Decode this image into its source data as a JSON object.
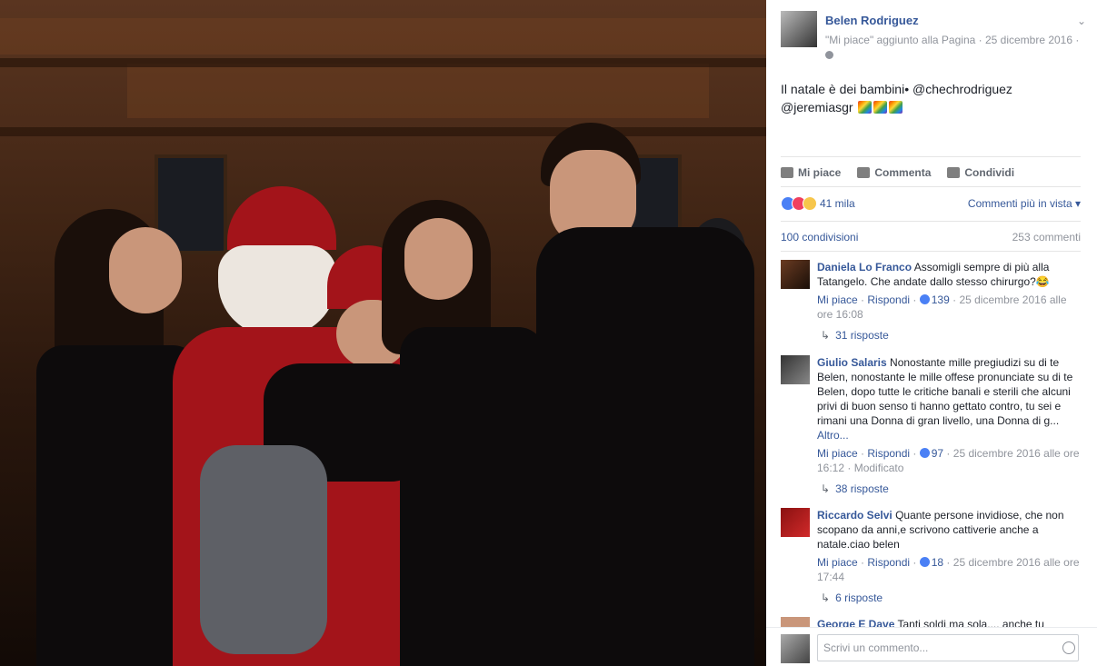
{
  "post": {
    "author": "Belen Rodriguez",
    "meta": "\"Mi piace\" aggiunto alla Pagina · 25 dicembre 2016 ·",
    "text": "Il natale è dei bambini• @chechrodriguez @jeremiasgr",
    "emoji_icon": "rainbow-emoji-icon"
  },
  "actions": {
    "like": "Mi piace",
    "comment": "Commenta",
    "share": "Condividi"
  },
  "stats": {
    "reactions": "41 mila",
    "sort": "Commenti più in vista",
    "shares": "100 condivisioni",
    "comments": "253 commenti"
  },
  "comments": [
    {
      "name": "Daniela Lo Franco",
      "text": "Assomigli sempre di più alla Tatangelo. Che andate dallo stesso chirurgo?😂",
      "like": "Mi piace",
      "reply": "Rispondi",
      "likes": "139",
      "time": "25 dicembre 2016 alle ore 16:08",
      "replies": "31 risposte"
    },
    {
      "name": "Giulio Salaris",
      "text": "Nonostante mille pregiudizi su di te Belen, nonostante le mille offese pronunciate su di te Belen, dopo tutte le critiche banali e sterili che alcuni privi di buon senso ti hanno gettato contro, tu sei e rimani una Donna di gran livello, una Donna di g...",
      "more": "Altro...",
      "like": "Mi piace",
      "reply": "Rispondi",
      "likes": "97",
      "time": "25 dicembre 2016 alle ore 16:12 · Modificato",
      "replies": "38 risposte"
    },
    {
      "name": "Riccardo Selvi",
      "text": "Quante persone invidiose, che non scopano da anni,e scrivono cattiverie anche a natale.ciao belen",
      "like": "Mi piace",
      "reply": "Rispondi",
      "likes": "18",
      "time": "25 dicembre 2016 alle ore 17:44",
      "replies": "6 risposte"
    },
    {
      "name": "George E Dave",
      "text": "Tanti soldi ma sola.... anche tu"
    }
  ],
  "composer": {
    "placeholder": "Scrivi un commento..."
  }
}
